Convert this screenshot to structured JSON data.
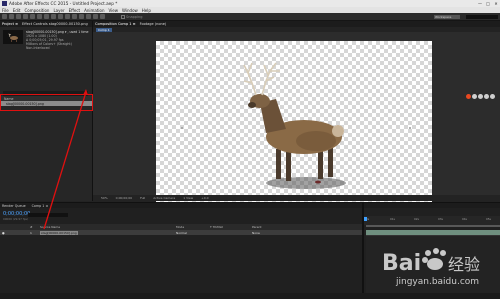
{
  "window": {
    "title": "Adobe After Effects CC 2015 - Untitled Project.aep *",
    "controls": [
      "—",
      "□",
      "✕"
    ]
  },
  "menu": [
    "File",
    "Edit",
    "Composition",
    "Layer",
    "Effect",
    "Animation",
    "View",
    "Window",
    "Help"
  ],
  "toolbar": {
    "snapping_label": "Snapping",
    "workspace_label": "Workspace"
  },
  "project_panel": {
    "tabs": [
      "Project ≡",
      "Effect Controls stag00000-00150.png"
    ],
    "item_name": "stag[00000-00150].png ▾ , used 1 time",
    "item_info_1": "1920 x 1080 (1.00)",
    "item_info_2": "Δ 0;00;05;01, 29.97 fps",
    "item_info_3": "Millions of Colors+ (Straight)",
    "item_info_4": "Non-Interlaced",
    "column_header": "Name",
    "selected_file": "stag[00000-00150].png"
  },
  "composition_panel": {
    "tabs": [
      "Composition Comp 1 ≡",
      "Footage (none)"
    ],
    "subtab": "Comp 1",
    "zoom": "50%",
    "timecode": "0;00;00;00",
    "resolution": "Full",
    "camera": "Active Camera",
    "views": "1 View",
    "exposure": "+0.0"
  },
  "timeline": {
    "tabs": [
      "Render Queue",
      "Comp 1 ≡"
    ],
    "current_time": "0;00;00;00",
    "fps": "00000 (29.97 fps)",
    "columns": {
      "num": "#",
      "source": "Source Name",
      "mode": "Mode",
      "trkmat": "T TrkMat",
      "parent": "Parent"
    },
    "layer": {
      "num": "1",
      "name": "stag[00000-00150].png",
      "mode": "Normal",
      "parent": "None"
    },
    "ruler": [
      "0s",
      "01s",
      "02s",
      "03s",
      "04s",
      "05s"
    ]
  },
  "watermark": {
    "brand": "Bai",
    "brand2": "经验",
    "url": "jingyan.baidu.com"
  },
  "colors": {
    "annotation_red": "#e01010",
    "timecode_blue": "#4ea4ff",
    "accent_blue": "#3b5c8a"
  }
}
